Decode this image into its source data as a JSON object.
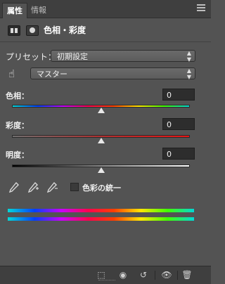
{
  "tabs": {
    "active": "属性",
    "inactive": "情報"
  },
  "header": {
    "title": "色相・彩度"
  },
  "preset": {
    "label": "プリセット：",
    "value": "初期設定"
  },
  "channel": {
    "value": "マスター"
  },
  "sliders": [
    {
      "label": "色相：",
      "value": "0",
      "level": 0.5
    },
    {
      "label": "彩度：",
      "value": "0",
      "level": 0.5
    },
    {
      "label": "明度：",
      "value": "0",
      "level": 0.5
    }
  ],
  "colorize": {
    "label": "色彩の統一",
    "checked": false
  },
  "icons": {
    "panel_menu": "menu-icon",
    "adjustment": "levels-icon",
    "mask": "mask-icon",
    "targeted_adjust": "hand-icon",
    "eyedroppers": [
      "eyedropper-icon",
      "eyedropper-plus-icon",
      "eyedropper-minus-icon"
    ],
    "bottom": [
      "clip-to-layer-icon",
      "view-previous-icon",
      "reset-icon",
      "visibility-icon",
      "trash-icon"
    ]
  }
}
